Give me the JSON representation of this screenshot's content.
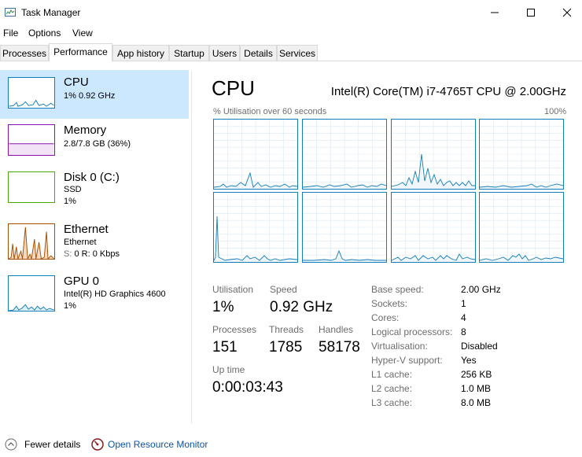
{
  "window": {
    "title": "Task Manager"
  },
  "menu": [
    "File",
    "Options",
    "View"
  ],
  "tabs": [
    "Processes",
    "Performance",
    "App history",
    "Startup",
    "Users",
    "Details",
    "Services"
  ],
  "sidebar": [
    {
      "title": "CPU",
      "sub1": "1% 0.92 GHz",
      "color": "#117dbb",
      "selected": true
    },
    {
      "title": "Memory",
      "sub1": "2.8/7.8 GB (36%)",
      "color": "#8b12ae"
    },
    {
      "title": "Disk 0 (C:)",
      "sub1": "SSD",
      "sub2": "1%",
      "color": "#4da60c"
    },
    {
      "title": "Ethernet",
      "sub1": "Ethernet",
      "sub2_label": "S:",
      "sub2_mid": "0 R:",
      "sub2_rest": "0 Kbps",
      "color": "#a74f01"
    },
    {
      "title": "GPU 0",
      "sub1": "Intel(R) HD Graphics 4600",
      "sub2": "1%",
      "color": "#117dbb"
    }
  ],
  "main": {
    "title": "CPU",
    "cpu_name": "Intel(R) Core(TM) i7-4765T CPU @ 2.00GHz",
    "graph_label": "% Utilisation over 60 seconds",
    "graph_max": "100%",
    "stats": {
      "utilisation_label": "Utilisation",
      "utilisation": "1%",
      "speed_label": "Speed",
      "speed": "0.92 GHz",
      "processes_label": "Processes",
      "processes": "151",
      "threads_label": "Threads",
      "threads": "1785",
      "handles_label": "Handles",
      "handles": "58178",
      "uptime_label": "Up time",
      "uptime": "0:00:03:43"
    },
    "details": [
      {
        "k": "Base speed:",
        "v": "2.00 GHz"
      },
      {
        "k": "Sockets:",
        "v": "1"
      },
      {
        "k": "Cores:",
        "v": "4"
      },
      {
        "k": "Logical processors:",
        "v": "8"
      },
      {
        "k": "Virtualisation:",
        "v": "Disabled"
      },
      {
        "k": "Hyper-V support:",
        "v": "Yes"
      },
      {
        "k": "L1 cache:",
        "v": "256 KB"
      },
      {
        "k": "L2 cache:",
        "v": "1.0 MB"
      },
      {
        "k": "L3 cache:",
        "v": "8.0 MB"
      }
    ]
  },
  "footer": {
    "fewer": "Fewer details",
    "monitor": "Open Resource Monitor"
  },
  "colors": {
    "cpu": "#117dbb",
    "selected": "#cce8ff",
    "link": "#0a54a6"
  }
}
